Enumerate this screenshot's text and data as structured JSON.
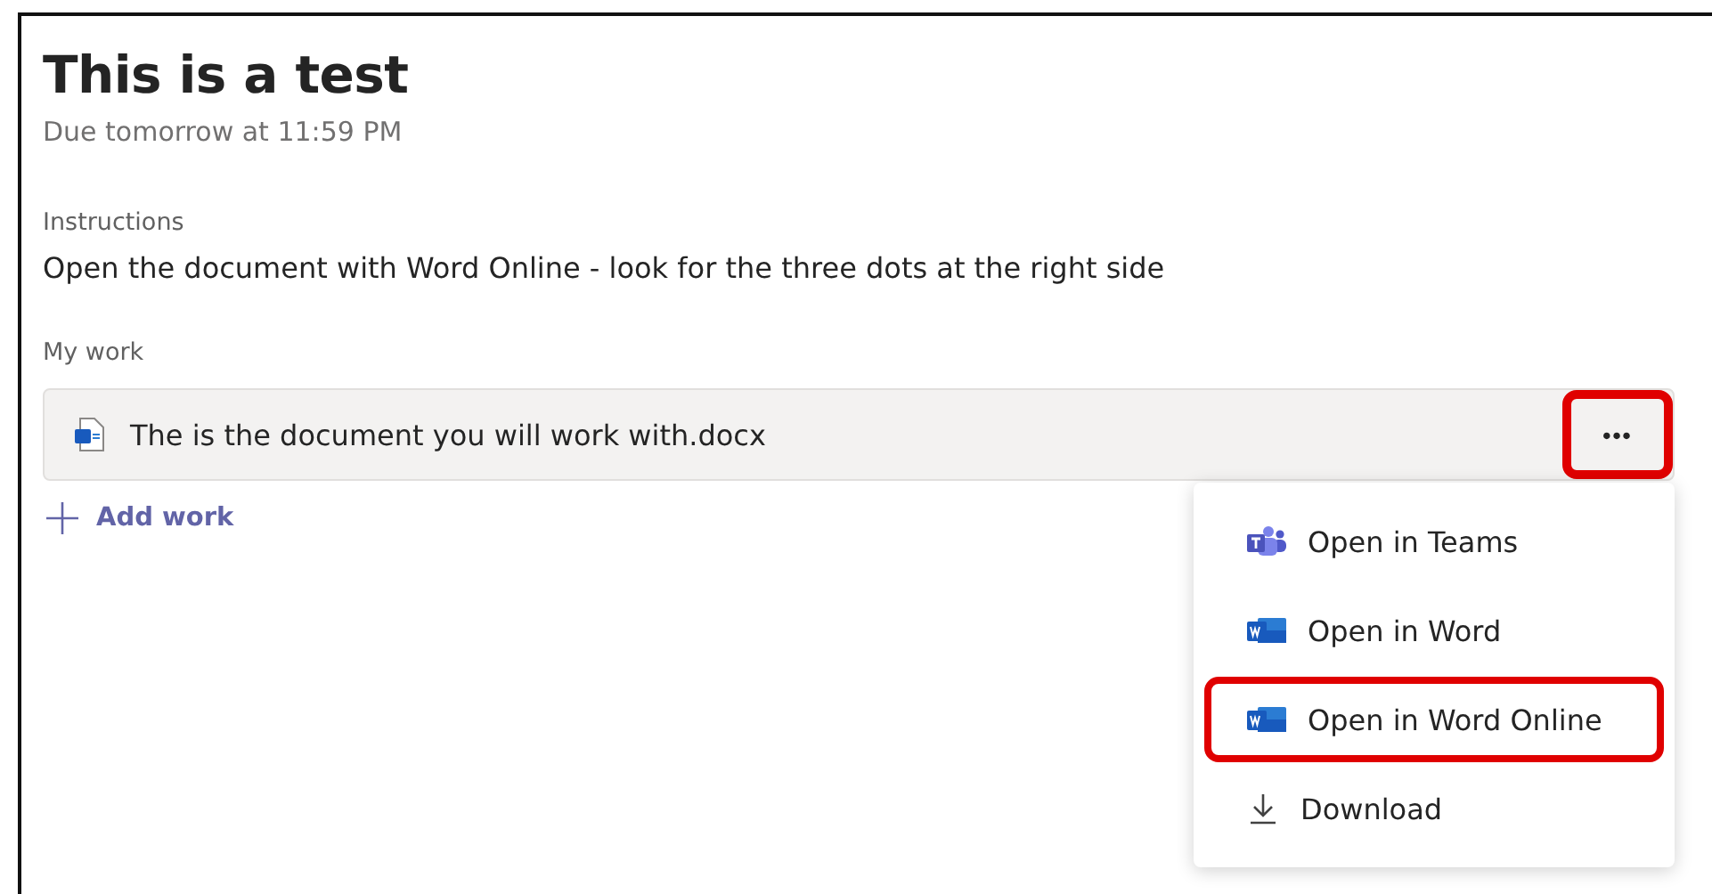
{
  "assignment": {
    "title": "This is a test",
    "due": "Due tomorrow at 11:59 PM"
  },
  "instructions": {
    "label": "Instructions",
    "text": "Open the document with Word Online - look for the three dots at the right side"
  },
  "my_work": {
    "label": "My work",
    "file": {
      "name": "The is the document you will work with.docx"
    },
    "more_button": {
      "label": "•••",
      "highlighted": true
    },
    "add_work": {
      "label": "Add work"
    }
  },
  "menu": {
    "items": [
      {
        "kind": "teams",
        "label": "Open in Teams",
        "highlighted": false
      },
      {
        "kind": "word",
        "label": "Open in Word",
        "highlighted": false
      },
      {
        "kind": "word",
        "label": "Open in Word Online",
        "highlighted": true
      },
      {
        "kind": "download",
        "label": "Download",
        "highlighted": false
      }
    ]
  }
}
